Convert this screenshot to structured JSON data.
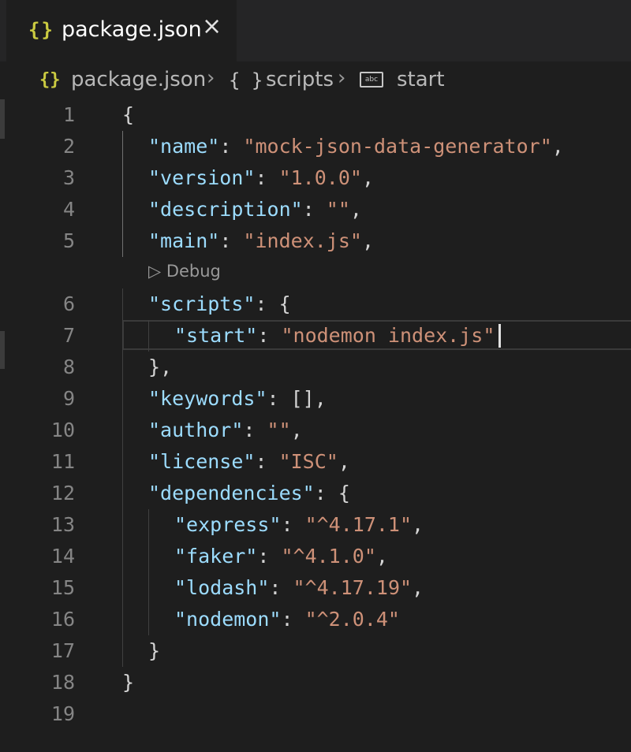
{
  "tab": {
    "icon": "{}",
    "label": "package.json",
    "close": "×"
  },
  "breadcrumb": {
    "file_icon": "{}",
    "file": "package.json",
    "sep": "›",
    "obj_icon": "{ }",
    "section": "scripts",
    "field_icon": "abc",
    "field": "start"
  },
  "codelens": {
    "label": "▷ Debug"
  },
  "editor": {
    "lines": [
      {
        "n": "1",
        "k": "",
        "s": "",
        "pre": "{",
        "post": ""
      },
      {
        "n": "2",
        "k": "\"name\"",
        "sep": ": ",
        "s": "\"mock-json-data-generator\"",
        "post": ","
      },
      {
        "n": "3",
        "k": "\"version\"",
        "sep": ": ",
        "s": "\"1.0.0\"",
        "post": ","
      },
      {
        "n": "4",
        "k": "\"description\"",
        "sep": ": ",
        "s": "\"\"",
        "post": ","
      },
      {
        "n": "5",
        "k": "\"main\"",
        "sep": ": ",
        "s": "\"index.js\"",
        "post": ","
      },
      {
        "n": "6",
        "k": "\"scripts\"",
        "sep": ": ",
        "s": "",
        "post": "{"
      },
      {
        "n": "7",
        "k": "\"start\"",
        "sep": ": ",
        "s": "\"nodemon index.js\"",
        "post": ""
      },
      {
        "n": "8",
        "k": "",
        "s": "",
        "pre": "},",
        "post": ""
      },
      {
        "n": "9",
        "k": "\"keywords\"",
        "sep": ": ",
        "s": "",
        "post": "[],"
      },
      {
        "n": "10",
        "k": "\"author\"",
        "sep": ": ",
        "s": "\"\"",
        "post": ","
      },
      {
        "n": "11",
        "k": "\"license\"",
        "sep": ": ",
        "s": "\"ISC\"",
        "post": ","
      },
      {
        "n": "12",
        "k": "\"dependencies\"",
        "sep": ": ",
        "s": "",
        "post": "{"
      },
      {
        "n": "13",
        "k": "\"express\"",
        "sep": ": ",
        "s": "\"^4.17.1\"",
        "post": ","
      },
      {
        "n": "14",
        "k": "\"faker\"",
        "sep": ": ",
        "s": "\"^4.1.0\"",
        "post": ","
      },
      {
        "n": "15",
        "k": "\"lodash\"",
        "sep": ": ",
        "s": "\"^4.17.19\"",
        "post": ","
      },
      {
        "n": "16",
        "k": "\"nodemon\"",
        "sep": ": ",
        "s": "\"^2.0.4\"",
        "post": ""
      },
      {
        "n": "17",
        "k": "",
        "s": "",
        "pre": "}",
        "post": ""
      },
      {
        "n": "18",
        "k": "",
        "s": "",
        "pre": "}",
        "post": ""
      },
      {
        "n": "19",
        "k": "",
        "s": "",
        "pre": "",
        "post": ""
      }
    ]
  },
  "colors": {
    "background": "#1e1e1e",
    "json_icon": "#cbcb41",
    "key": "#9cdcfe",
    "string": "#ce9178",
    "line_number": "#858585"
  },
  "icons": [
    "json-file-icon",
    "close-icon",
    "object-icon",
    "string-property-icon",
    "debug-run-icon"
  ]
}
